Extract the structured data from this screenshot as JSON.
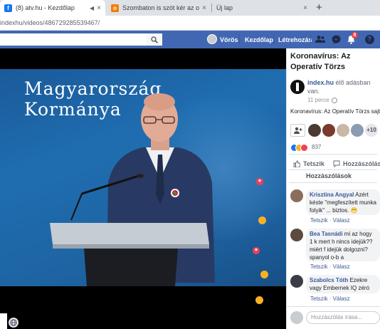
{
  "browser": {
    "tabs": [
      {
        "title": "(8) atv.hu - Kezdőlap",
        "favicon": "facebook-icon",
        "active": true
      },
      {
        "title": "Szombaton is szót kér az operatí",
        "favicon": "article-icon",
        "active": false
      },
      {
        "title": "Új lap",
        "favicon": "",
        "active": false
      }
    ],
    "url": "indexhu/videos/486729285539467/",
    "new_tab_glyph": "+",
    "close_glyph": "×"
  },
  "facebook": {
    "brand_color": "#4267b2",
    "nav": {
      "profile_name": "Vörös",
      "home": "Kezdőlap",
      "create": "Létrehozás",
      "notification_badge": "8"
    }
  },
  "video": {
    "title_line1": "Magyarország",
    "title_line2": "Kormánya"
  },
  "sidebar": {
    "title": "Koronavírus: Az Operatív Törzs sajtótájékoztatót tart",
    "page_name": "index.hu",
    "live_text": "élő adásban van.",
    "time": "11 perce",
    "description": "Koronavírus: Az Operatív Törzs sajtótájékoztatót tart",
    "viewers_more": "+10",
    "reaction_count": "837",
    "like_label": "Tetszik",
    "comment_label": "Hozzászólás",
    "comments_header": "Hozzászólások",
    "comments": [
      {
        "name": "Krisztina Angyal",
        "text": "Azért késte \"megfeszített munka folyik\" ... biztos. 😁",
        "like": "Tetszik",
        "reply": "Válasz"
      },
      {
        "name": "Bea Tasnádi",
        "text": "mi az hogy 1 k mert h nincs idejük?? miért f idejük dolgozni? spanyol o-b a felvilágosítást!",
        "like": "Tetszik",
        "reply": "Válasz"
      },
      {
        "name": "Szabolcs Tóth",
        "text": "Ezekre vagy Embernek IQ zéró",
        "like": "Tetszik",
        "reply": "Válasz"
      }
    ],
    "write_placeholder": "Hozzászólás írása..."
  }
}
